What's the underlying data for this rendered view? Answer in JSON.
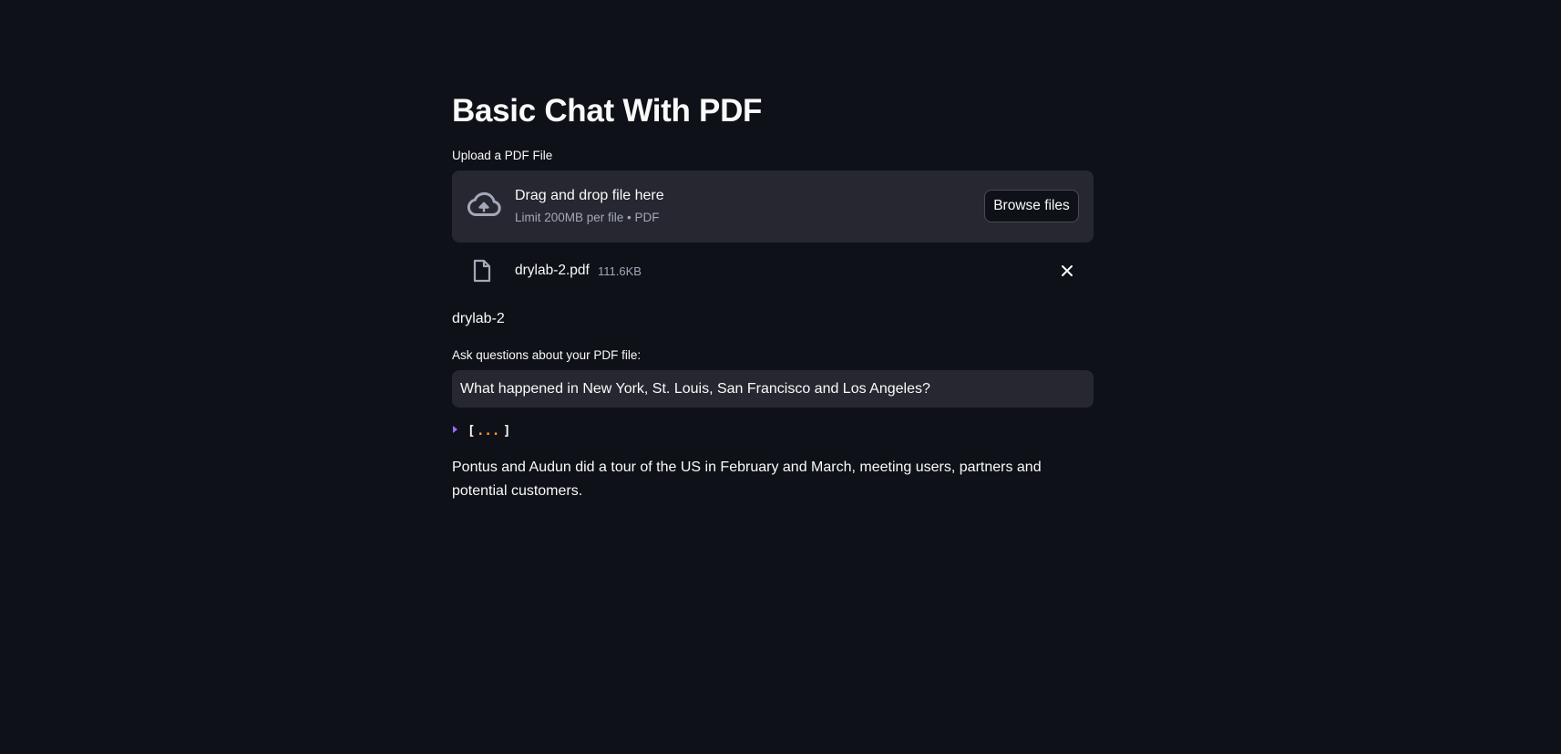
{
  "app": {
    "title": "Basic Chat With PDF"
  },
  "uploader": {
    "label": "Upload a PDF File",
    "dropzone_text": "Drag and drop file here",
    "limit_text": "Limit 200MB per file • PDF",
    "browse_label": "Browse files",
    "icon": "cloud-upload-icon"
  },
  "uploaded_file": {
    "name": "drylab-2.pdf",
    "size": "111.6KB",
    "icon": "file-icon",
    "remove_icon": "close-icon"
  },
  "document": {
    "name": "drylab-2"
  },
  "question": {
    "label": "Ask questions about your PDF file:",
    "value": "What happened in New York, St. Louis, San Francisco and Los Angeles?"
  },
  "json_viewer": {
    "open": "[",
    "ellipsis": "...",
    "close": "]",
    "toggle_color": "#9a6dff",
    "ellipsis_color": "#ff9a3c"
  },
  "answer": {
    "text": "Pontus and Audun did a tour of the US in February and March, meeting users, partners and potential customers."
  },
  "colors": {
    "background": "#0e1117",
    "surface": "#262730",
    "text": "#fafafa",
    "muted_text": "#a3a8b8"
  }
}
